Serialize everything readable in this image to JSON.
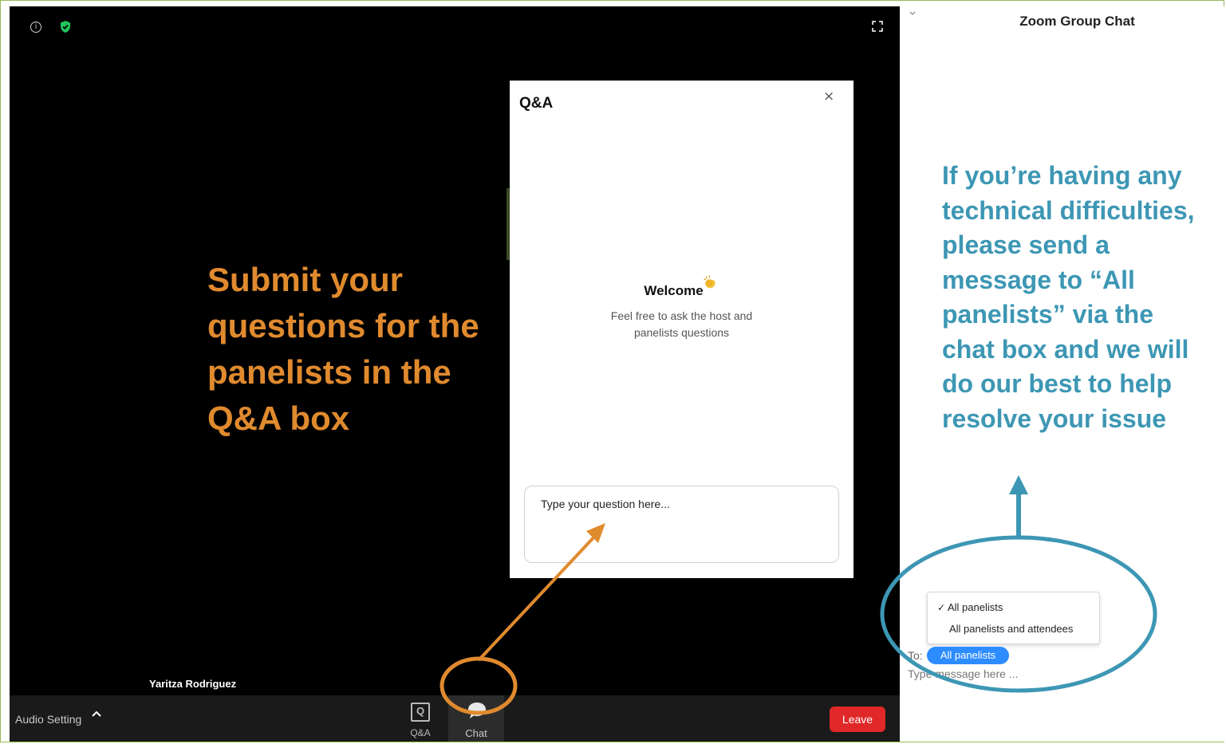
{
  "meeting": {
    "participant_name": "Yaritza Rodriguez"
  },
  "toolbar": {
    "audio_setting_label": "Audio Setting",
    "qa_label": "Q&A",
    "qa_icon_letter": "Q",
    "chat_label": "Chat",
    "leave_label": "Leave"
  },
  "qa_panel": {
    "title": "Q&A",
    "close_glyph": "×",
    "welcome_title": "Welcome",
    "welcome_subtitle": "Feel free to ask the host and panelists questions",
    "question_placeholder": "Type your question here..."
  },
  "chat_panel": {
    "title": "Zoom Group Chat",
    "recipient_options": [
      "All panelists",
      "All panelists and attendees"
    ],
    "selected_recipient": "All panelists",
    "check_glyph": "✓",
    "to_label": "To:",
    "message_placeholder": "Type message here ..."
  },
  "annotations": {
    "left_callout": "Submit your questions for the panelists in the Q&A box",
    "right_callout": "If you’re having any technical difficulties, please send a message to “All panelists” via the chat box and we will do our best to help resolve your issue"
  },
  "icons": {
    "info": "info-icon",
    "shield": "shield-check-icon",
    "fullscreen": "fullscreen-icon",
    "audio_caret": "caret-up-icon",
    "qa": "qa-icon",
    "chat": "chat-bubble-icon",
    "collapse": "chevron-down-icon",
    "clap": "clapping-hands-icon"
  },
  "colors": {
    "video_bg": "#000000",
    "toolbar_bg": "#1a1a1a",
    "leave_red": "#e02828",
    "accent_blue": "#2d8cff",
    "orange_annotation": "#e08a2e",
    "teal_annotation": "#3d97b4",
    "shield_green": "#22c55e"
  }
}
